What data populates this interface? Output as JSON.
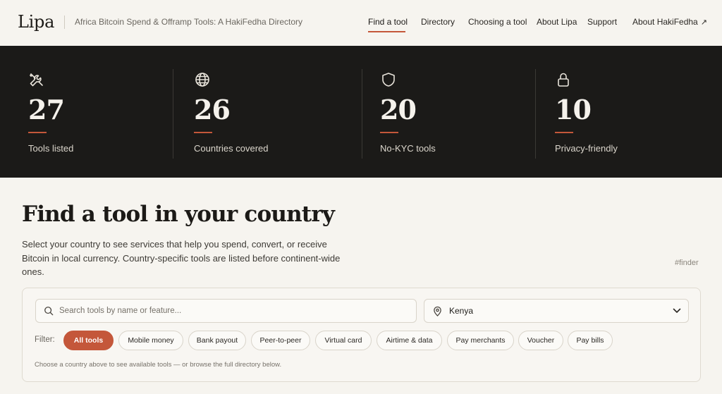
{
  "header": {
    "logo": "Lipa",
    "tagline": "Africa Bitcoin Spend & Offramp Tools: A HakiFedha Directory",
    "nav": [
      {
        "label": "Find a tool",
        "active": true
      },
      {
        "label": "Directory"
      },
      {
        "label": "Choosing a tool"
      },
      {
        "label": "About Lipa"
      },
      {
        "label": "Support"
      },
      {
        "label": "About HakiFedha",
        "external_icon": "↗"
      }
    ]
  },
  "stats": [
    {
      "icon": "tools-icon",
      "value": "27",
      "label": "Tools listed"
    },
    {
      "icon": "globe-icon",
      "value": "26",
      "label": "Countries covered"
    },
    {
      "icon": "shield-icon",
      "value": "20",
      "label": "No-KYC tools"
    },
    {
      "icon": "lock-icon",
      "value": "10",
      "label": "Privacy-friendly"
    }
  ],
  "finder": {
    "title": "Find a tool in your country",
    "intro": "Select your country to see services that help you spend, convert, or receive Bitcoin in local currency. Country-specific tools are listed before continent-wide ones.",
    "anchor": "#finder",
    "search_placeholder": "Search tools by name or feature...",
    "search_value": "",
    "country": "Kenya",
    "filter_label": "Filter:",
    "filters": [
      {
        "label": "All tools",
        "active": true
      },
      {
        "label": "Mobile money"
      },
      {
        "label": "Bank payout"
      },
      {
        "label": "Peer-to-peer"
      },
      {
        "label": "Virtual card"
      },
      {
        "label": "Airtime & data"
      },
      {
        "label": "Pay merchants"
      },
      {
        "label": "Voucher"
      },
      {
        "label": "Pay bills"
      }
    ],
    "hint": "Choose a country above to see available tools — or browse the full directory below."
  },
  "colors": {
    "accent": "#c4573a",
    "dark_band": "#1b1a18",
    "background": "#f6f4ef"
  }
}
